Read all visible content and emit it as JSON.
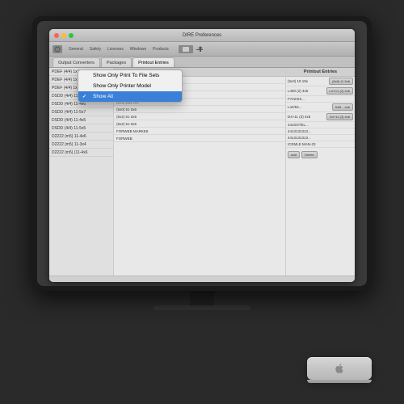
{
  "window": {
    "title": "DIRE Preferences",
    "trafficLights": {
      "close": "close",
      "minimize": "minimize",
      "maximize": "maximize"
    }
  },
  "toolbar": {
    "items": [
      "General",
      "Safety",
      "Licenses",
      "Windows",
      "Products",
      "Updates tab"
    ]
  },
  "tabs": {
    "items": [
      {
        "label": "Output Converters",
        "active": false
      },
      {
        "label": "Packages",
        "active": false
      },
      {
        "label": "Printout Entries",
        "active": true
      }
    ]
  },
  "dropdown": {
    "items": [
      {
        "label": "Show Only Print To File Sets",
        "active": false,
        "checked": false
      },
      {
        "label": "Show Only Printer Model",
        "active": false,
        "checked": false
      },
      {
        "label": "Show All",
        "active": true,
        "checked": true
      }
    ]
  },
  "leftPanel": {
    "rows": [
      "PDEF (4/4) 1x1",
      "PDEF (4/4) 1x1",
      "PDEF (4/4) 1x1",
      "DSDD (4/4) 11-3x5",
      "DSDD (4/4) 11-4x6",
      "DSDD (4/4) 11-5x7",
      "DSDD (4/4) 11-4x5",
      "DSDD (4/4) 11-5x5",
      "D2222 (m5) 11-4x6",
      "D2222 (m5) 11-3x4",
      "D2222 (m5) (11-4x6"
    ]
  },
  "centerPanel": {
    "header": "Packages",
    "rows": [
      "(5x6) (11) 0x6",
      "(5x6) (11) 0x6",
      "(5x6) 51 0x6",
      "(5x6) (11) 0x6",
      "(5x0) 51 0x6",
      "(5x2) 61 0x5",
      "(5x2) 51 0x5",
      "FORWEB MARKE6",
      "FORWEB"
    ]
  },
  "rightPanel": {
    "header": "Printout Entries",
    "rows": [
      {
        "left": "(5x3) 19 19x",
        "right": "(5x5) 11 5x6"
      },
      {
        "left": "L450 (2) 4x5",
        "right": "L4+C1 (2) 4x6"
      },
      {
        "left": "F7223Hi...",
        "right": ""
      },
      {
        "left": "L44/94...",
        "right": "S4B... 4x6"
      },
      {
        "left": "D4+11 (3) 4x5",
        "right": "D4+11 (3) 4x6"
      },
      {
        "left": "4410/4TEL...",
        "right": ""
      },
      {
        "left": "4413131313...",
        "right": ""
      },
      {
        "left": "4413131313...",
        "right": ""
      },
      {
        "left": "",
        "right": "ICEMLE MAN-23"
      }
    ],
    "buttons": [
      "Add",
      "Delete"
    ]
  },
  "statusBar": {
    "text": ""
  },
  "macMini": {
    "visible": true
  }
}
